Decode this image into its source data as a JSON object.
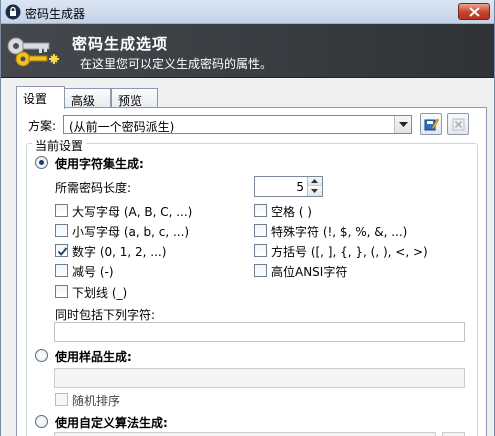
{
  "window": {
    "title": "密码生成器",
    "close_label": "✕"
  },
  "banner": {
    "heading": "密码生成选项",
    "subheading": "在这里您可以定义生成密码的属性。"
  },
  "tabs": [
    {
      "label": "设置"
    },
    {
      "label": "高级"
    },
    {
      "label": "预览"
    }
  ],
  "profile": {
    "label": "方案:",
    "selected": "(从前一个密码派生)"
  },
  "group": {
    "title": "当前设置"
  },
  "charset": {
    "radio_label": "使用字符集生成:",
    "length_label": "所需密码长度:",
    "length_value": "5",
    "options": [
      {
        "label": "大写字母 (A, B, C, ...)",
        "checked": false
      },
      {
        "label": "小写字母 (a, b, c, ...)",
        "checked": false
      },
      {
        "label": "数字 (0, 1, 2, ...)",
        "checked": true
      },
      {
        "label": "减号 (-)",
        "checked": false
      },
      {
        "label": "下划线 (_)",
        "checked": false
      },
      {
        "label": "空格 ( )",
        "checked": false
      },
      {
        "label": "特殊字符 (!, $, %, &, ...)",
        "checked": false
      },
      {
        "label": "方括号 ([, ], {, }, (, ), <, >)",
        "checked": false
      },
      {
        "label": "高位ANSI字符",
        "checked": false
      }
    ],
    "include_label": "同时包括下列字符:",
    "include_value": ""
  },
  "pattern": {
    "radio_label": "使用样品生成:",
    "shuffle_label": "随机排序"
  },
  "custom": {
    "radio_label": "使用自定义算法生成:"
  },
  "colors": {
    "banner": "#3a3e43",
    "accent": "#1e3d6b",
    "close": "#c7422a"
  }
}
